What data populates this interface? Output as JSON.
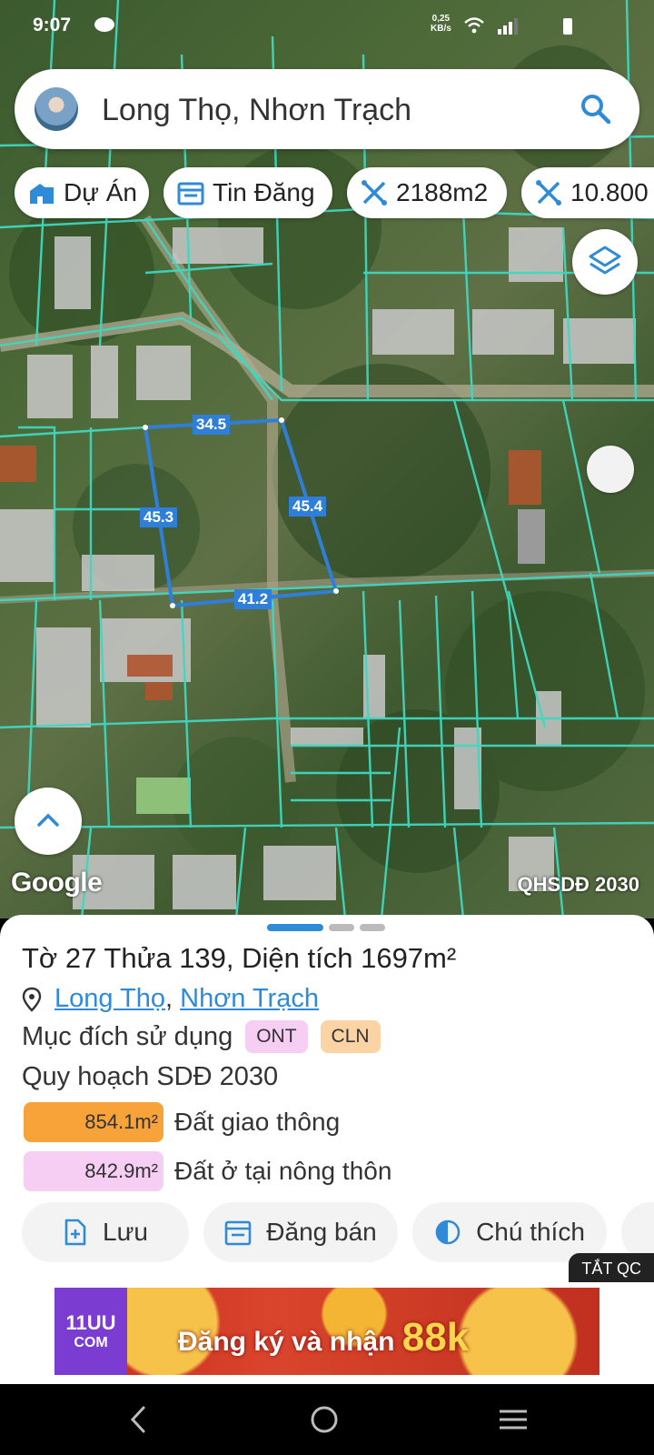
{
  "status": {
    "time": "9:07",
    "speed_value": "0,25",
    "speed_unit": "KB/s"
  },
  "search": {
    "text": "Long Thọ, Nhơn Trạch"
  },
  "chips": [
    {
      "label": "Dự Án",
      "icon": "building-icon"
    },
    {
      "label": "Tin Đăng",
      "icon": "calendar-icon"
    },
    {
      "label": "2188m2",
      "icon": "ruler-icon"
    },
    {
      "label": "10.800",
      "icon": "ruler-icon"
    }
  ],
  "map": {
    "dimensions": [
      "34.5",
      "45.3",
      "45.4",
      "41.2"
    ],
    "google_logo": "Google",
    "overlay_label": "QHSDĐ 2030",
    "parcel_line_color": "#3fd8c0",
    "selection_color": "#2f7fd9"
  },
  "sheet": {
    "title": "Tờ 27 Thửa 139, Diện tích 1697m²",
    "location": [
      "Long Thọ",
      "Nhơn Trạch"
    ],
    "purpose_label": "Mục đích sử dụng",
    "purpose_tags": [
      {
        "code": "ONT",
        "color": "#f6cdf3"
      },
      {
        "code": "CLN",
        "color": "#fbd3a4"
      }
    ],
    "plan_label": "Quy hoạch SDĐ 2030",
    "areas": [
      {
        "value": "854.1m²",
        "label": "Đất giao thông",
        "color": "#f7a33a"
      },
      {
        "value": "842.9m²",
        "label": "Đất ở tại nông thôn",
        "color": "#f6cdf3"
      }
    ],
    "actions": [
      {
        "label": "Lưu",
        "icon": "save-icon"
      },
      {
        "label": "Đăng bán",
        "icon": "post-icon"
      },
      {
        "label": "Chú thích",
        "icon": "legend-icon"
      }
    ],
    "ad_close": "TẮT QC"
  },
  "ad": {
    "logo_top": "11UU",
    "logo_bottom": "COM",
    "text": "Đăng ký và nhận",
    "amount": "88k"
  }
}
